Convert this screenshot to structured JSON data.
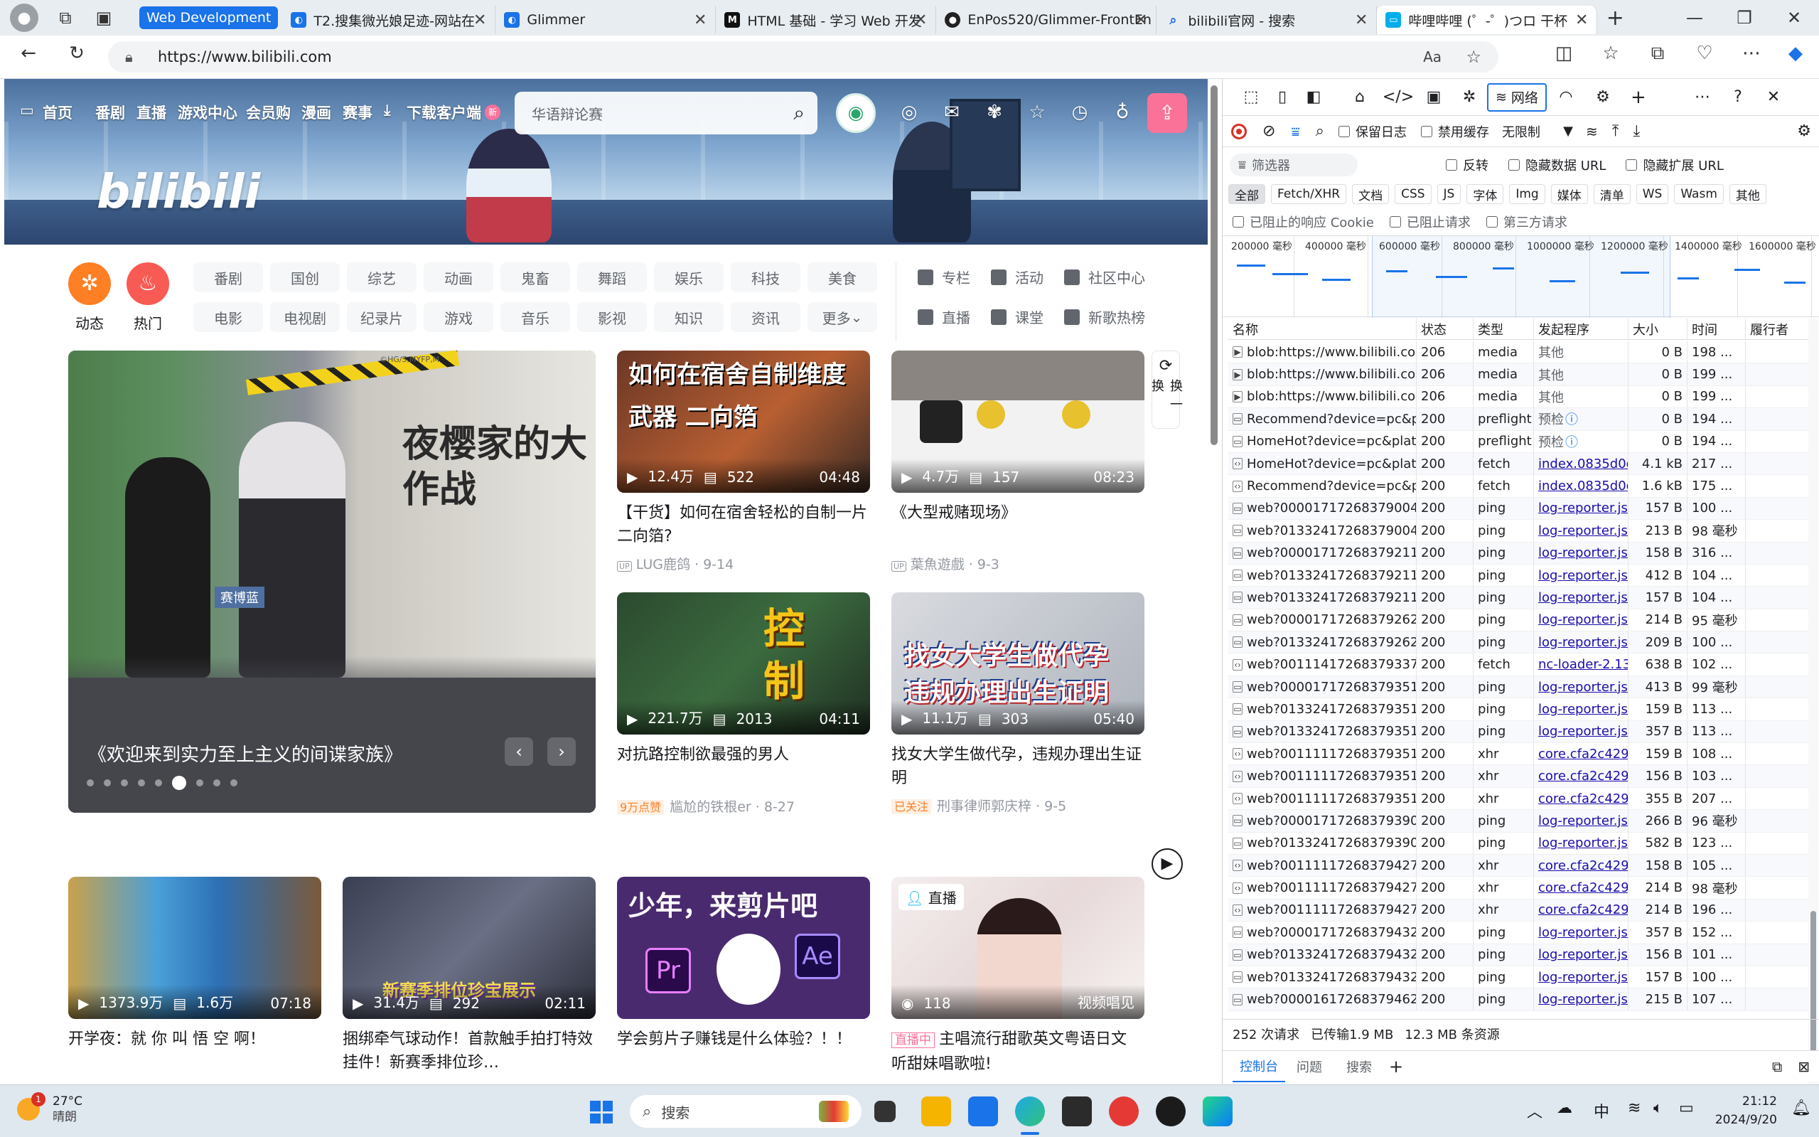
{
  "browser": {
    "tabs": [
      {
        "label": "Web Development",
        "group": true
      },
      {
        "label": "T2.搜集微光娘足迹-网站在",
        "icon": "tab-icon-blue"
      },
      {
        "label": "Glimmer",
        "icon": "tab-icon-blue"
      },
      {
        "label": "HTML 基础 - 学习 Web 开发",
        "icon": "tab-icon-mdn"
      },
      {
        "label": "EnPos520/Glimmer-FrontEn",
        "icon": "github-icon"
      },
      {
        "label": "bilibili官网 - 搜索",
        "icon": "search-icon"
      },
      {
        "label": "哔哩哔哩 (゜-゜)つロ 干杯",
        "icon": "bilibili-icon",
        "active": true
      }
    ],
    "url": "https://www.bilibili.com"
  },
  "bili": {
    "nav": [
      "首页",
      "番剧",
      "直播",
      "游戏中心",
      "会员购",
      "漫画",
      "赛事",
      "下载客户端"
    ],
    "nav_badge": "新",
    "search_placeholder": "华语辩论赛",
    "logo": "bilibili",
    "left_big": [
      {
        "label": "动态"
      },
      {
        "label": "热门"
      }
    ],
    "chips_row1": [
      "番剧",
      "国创",
      "综艺",
      "动画",
      "鬼畜",
      "舞蹈",
      "娱乐",
      "科技",
      "美食"
    ],
    "chips_row2": [
      "电影",
      "电视剧",
      "纪录片",
      "游戏",
      "音乐",
      "影视",
      "知识",
      "资讯",
      "更多"
    ],
    "right_links_row1": [
      "专栏",
      "活动",
      "社区中心"
    ],
    "right_links_row2": [
      "直播",
      "课堂",
      "新歌热榜"
    ],
    "refresh_label": "换一换",
    "carousel": {
      "title": "《欢迎来到实力至上主义的间谍家族》",
      "thumb_text": "夜樱家的大作战",
      "thumb_tag": "赛博蓝",
      "watermark": "©HG/S,MYFP,M",
      "dots": 9,
      "active_dot": 5
    },
    "cards": [
      {
        "title": "【干货】如何在宿舍轻松的自制一片二向箔?",
        "views": "12.4万",
        "danmaku": "522",
        "duration": "04:48",
        "author": "LUG鹿鸽",
        "date": "9-14",
        "thumb_text": "如何在宿舍自制维度武器 二向箔",
        "up_tag": "UP"
      },
      {
        "title": "《大型戒赌现场》",
        "views": "4.7万",
        "danmaku": "157",
        "duration": "08:23",
        "author": "葉魚遊戲",
        "date": "9-3",
        "up_tag": "UP"
      },
      {
        "title": "对抗路控制欲最强的男人",
        "views": "221.7万",
        "danmaku": "2013",
        "duration": "04:11",
        "author": "尴尬的铁根er",
        "date": "8-27",
        "thumb_text": "控制",
        "badge": "9万点赞"
      },
      {
        "title": "找女大学生做代孕，违规办理出生证明",
        "views": "11.1万",
        "danmaku": "303",
        "duration": "05:40",
        "author": "刑事律师郭庆梓",
        "date": "9-5",
        "thumb_text": "找女大学生做代孕 违规办理出生证明",
        "badge": "已关注"
      },
      {
        "title": "开学夜：就 你 叫 悟 空 啊！",
        "views": "1373.9万",
        "danmaku": "1.6万",
        "duration": "07:18"
      },
      {
        "title": "捆绑牵气球动作！首款触手拍打特效挂件！新赛季排位珍…",
        "views": "31.4万",
        "danmaku": "292",
        "duration": "02:11",
        "thumb_text": "新赛季排位珍宝展示"
      },
      {
        "title": "学会剪片子赚钱是什么体验？！！",
        "thumb_text": "少年，来剪片吧"
      },
      {
        "title": "主唱流行甜歌英文粤语日文 听甜妹唱歌啦!",
        "views": "118",
        "live_tag": "直播",
        "live_badge": "直播中",
        "corner": "视频唱见"
      }
    ]
  },
  "devtools": {
    "tabs": [
      "网络"
    ],
    "preserve_log": "保留日志",
    "disable_cache": "禁用缓存",
    "throttle": "无限制",
    "filter_placeholder": "筛选器",
    "invert": "反转",
    "hide_data_url": "隐藏数据 URL",
    "hide_ext_url": "隐藏扩展 URL",
    "types": [
      "全部",
      "Fetch/XHR",
      "文档",
      "CSS",
      "JS",
      "字体",
      "Img",
      "媒体",
      "清单",
      "WS",
      "Wasm",
      "其他"
    ],
    "blocked_cookies": "已阻止的响应 Cookie",
    "blocked_requests": "已阻止请求",
    "third_party": "第三方请求",
    "timeline_ticks": [
      "200000 毫秒",
      "400000 毫秒",
      "600000 毫秒",
      "800000 毫秒",
      "1000000 毫秒",
      "1200000 毫秒",
      "1400000 毫秒",
      "1600000 毫秒"
    ],
    "columns": [
      "名称",
      "状态",
      "类型",
      "发起程序",
      "大小",
      "时间",
      "履行者"
    ],
    "rows": [
      [
        "blob:https://www.bilibili.co...",
        "206",
        "media",
        "其他",
        "0 B",
        "198 ..."
      ],
      [
        "blob:https://www.bilibili.co...",
        "206",
        "media",
        "其他",
        "0 B",
        "199 ..."
      ],
      [
        "blob:https://www.bilibili.co...",
        "206",
        "media",
        "其他",
        "0 B",
        "199 ..."
      ],
      [
        "Recommend?device=pc&p...",
        "200",
        "preflight",
        "预检",
        "0 B",
        "194 ..."
      ],
      [
        "HomeHot?device=pc&plat...",
        "200",
        "preflight",
        "预检",
        "0 B",
        "194 ..."
      ],
      [
        "HomeHot?device=pc&plat...",
        "200",
        "fetch",
        "index.0835d0d0...",
        "4.1 kB",
        "217 ..."
      ],
      [
        "Recommend?device=pc&p...",
        "200",
        "fetch",
        "index.0835d0d0...",
        "1.6 kB",
        "175 ..."
      ],
      [
        "web?000017172683790049...",
        "200",
        "ping",
        "log-reporter.js:2",
        "157 B",
        "100 ..."
      ],
      [
        "web?013324172683790049...",
        "200",
        "ping",
        "log-reporter.js:2",
        "213 B",
        "98 毫秒"
      ],
      [
        "web?000017172683792114...",
        "200",
        "ping",
        "log-reporter.js:2",
        "158 B",
        "316 ..."
      ],
      [
        "web?013324172683792115...",
        "200",
        "ping",
        "log-reporter.js:2",
        "412 B",
        "104 ..."
      ],
      [
        "web?013324172683792115...",
        "200",
        "ping",
        "log-reporter.js:2",
        "157 B",
        "104 ..."
      ],
      [
        "web?000017172683792625...",
        "200",
        "ping",
        "log-reporter.js:2",
        "214 B",
        "95 毫秒"
      ],
      [
        "web?013324172683792626...",
        "200",
        "ping",
        "log-reporter.js:2",
        "209 B",
        "100 ..."
      ],
      [
        "web?001114172683793379...",
        "200",
        "fetch",
        "nc-loader-2.13.0...",
        "638 B",
        "102 ..."
      ],
      [
        "web?000017172683793518...",
        "200",
        "ping",
        "log-reporter.js:2",
        "413 B",
        "99 毫秒"
      ],
      [
        "web?013324172683793518...",
        "200",
        "ping",
        "log-reporter.js:2",
        "159 B",
        "113 ..."
      ],
      [
        "web?013324172683793518...",
        "200",
        "ping",
        "log-reporter.js:2",
        "357 B",
        "113 ..."
      ],
      [
        "web?001111172683793518...",
        "200",
        "xhr",
        "core.cfa2c429.js:...",
        "159 B",
        "108 ..."
      ],
      [
        "web?001111172683793518...",
        "200",
        "xhr",
        "core.cfa2c429.js:...",
        "156 B",
        "103 ..."
      ],
      [
        "web?001111172683793518...",
        "200",
        "xhr",
        "core.cfa2c429.js:...",
        "355 B",
        "207 ..."
      ],
      [
        "web?000017172683793901...",
        "200",
        "ping",
        "log-reporter.js:2",
        "266 B",
        "96 毫秒"
      ],
      [
        "web?013324172683793901...",
        "200",
        "ping",
        "log-reporter.js:2",
        "582 B",
        "123 ..."
      ],
      [
        "web?001111172683794279...",
        "200",
        "xhr",
        "core.cfa2c429.js:...",
        "158 B",
        "105 ..."
      ],
      [
        "web?001111172683794279...",
        "200",
        "xhr",
        "core.cfa2c429.js:...",
        "214 B",
        "98 毫秒"
      ],
      [
        "web?001111172683794279...",
        "200",
        "xhr",
        "core.cfa2c429.js:...",
        "214 B",
        "196 ..."
      ],
      [
        "web?000017172683794326...",
        "200",
        "ping",
        "log-reporter.js:2",
        "357 B",
        "152 ..."
      ],
      [
        "web?013324172683794326...",
        "200",
        "ping",
        "log-reporter.js:2",
        "156 B",
        "101 ..."
      ],
      [
        "web?013324172683794326...",
        "200",
        "ping",
        "log-reporter.js:2",
        "157 B",
        "100 ..."
      ],
      [
        "web?000016172683794621...",
        "200",
        "ping",
        "log-reporter.js:2",
        "215 B",
        "107 ..."
      ]
    ],
    "summary": [
      "252 次请求",
      "已传输1.9 MB",
      "12.3 MB 条资源"
    ],
    "drawer_tabs": [
      "控制台",
      "问题",
      "搜索"
    ]
  },
  "taskbar": {
    "weather_temp": "27°C",
    "weather_desc": "晴朗",
    "weather_badge": "1",
    "search_placeholder": "搜索",
    "ime": "中",
    "time": "21:12",
    "date": "2024/9/20"
  },
  "colors": {
    "bili_pink": "#fb7299",
    "bili_blue": "#00aeec",
    "dev_blue": "#1a73e8",
    "dev_link": "#1a0dab"
  }
}
